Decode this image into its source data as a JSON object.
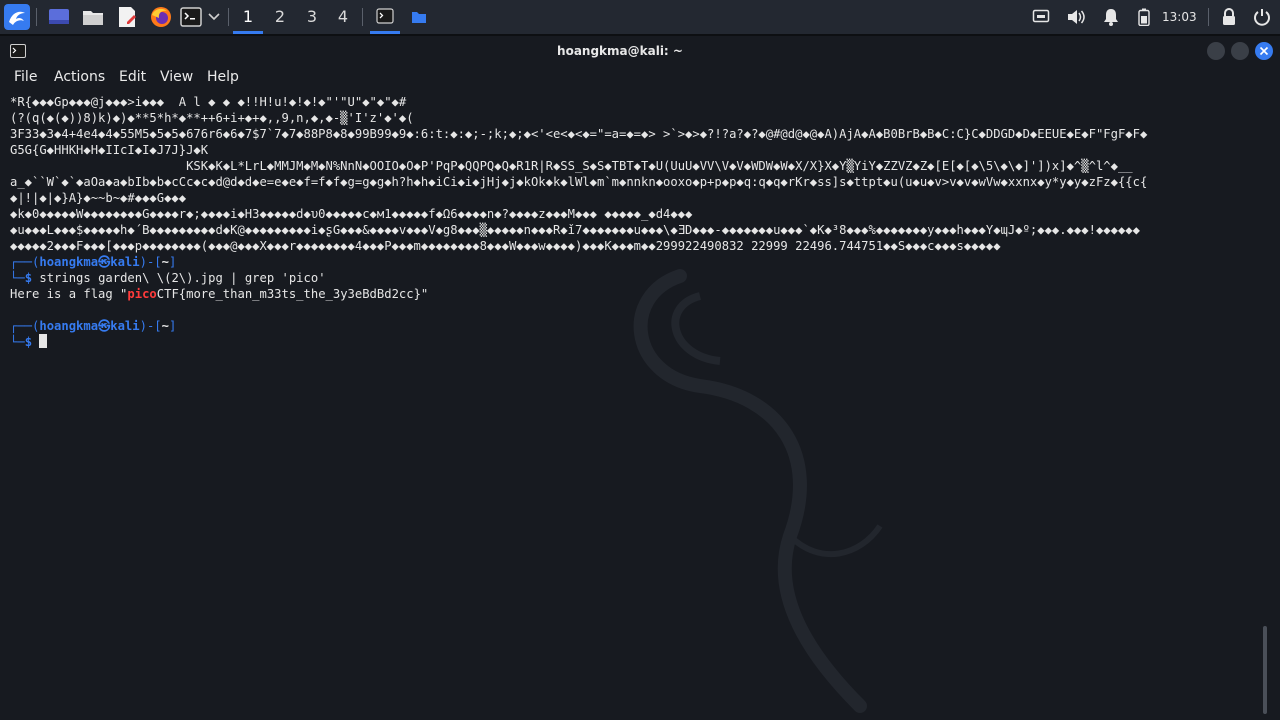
{
  "taskbar": {
    "workspaces": [
      "1",
      "2",
      "3",
      "4"
    ],
    "active_workspace": "1",
    "clock": "13:03",
    "accent_color": "#367bf0"
  },
  "window": {
    "title": "hoangkma@kali: ~",
    "menu": [
      "File",
      "Actions",
      "Edit",
      "View",
      "Help"
    ]
  },
  "terminal": {
    "binary_output": [
      "*R{◆◆◆Gp◆◆◆@j◆◆◆>i◆◆◆  A l ◆ ◆ ◆!!H!u!◆!◆!◆\"'\"U\"◆\"◆\"◆#",
      "(?(q(◆(◆))8)k)◆)◆**5*h*◆**++6+i+◆+◆,,9,n,◆,◆-▒'I'z'◆'◆(",
      "3F33◆3◆4+4e4◆4◆55M5◆5◆5◆676r6◆6◆7$7`7◆7◆88P8◆8◆99B99◆9◆:6:t:◆:◆;-;k;◆;◆<'<e<◆<◆=\"=a=◆=◆> >`>◆>◆?!?a?◆?◆@#@d@◆@◆A)AjA◆A◆B0BrB◆B◆C:C}C◆DDGD◆D◆EEUE◆E◆F\"FgF◆F◆",
      "G5G{G◆HHKH◆H◆IIcI◆I◆J7J}J◆K",
      "                        KSK◆K◆L*LrL◆MMJM◆M◆N%NnN◆OOIO◆O◆P'PqP◆QQPQ◆Q◆R1R|R◆SS_S◆S◆TBT◆T◆U(UuU◆VV\\V◆V◆WDW◆W◆X/X}X◆Y▒YiY◆ZZVZ◆Z◆[E[◆[◆\\5\\◆\\◆]'])x]◆^▒^l^◆__",
      "a_◆``W`◆`◆aOa◆a◆bIb◆b◆cCc◆c◆d@d◆d◆e=e◆e◆f=f◆f◆g=g◆g◆h?h◆h◆iCi◆i◆jHj◆j◆kOk◆k◆lWl◆m`m◆nnkn◆ooxo◆p+p◆p◆q:q◆q◆rKr◆ss]s◆ttpt◆u(u◆u◆v>v◆v◆wVw◆xxnx◆y*y◆y◆zFz◆{{c{",
      "◆|!|◆|◆}A}◆~~b~◆#◆◆◆G◆◆◆",
      "◆k◆0◆◆◆◆◆W◆◆◆◆◆◆◆◆G◆◆◆◆r◆;◆◆◆◆i◆H3◆◆◆◆◆d◆υ0◆◆◆◆◆c◆м1◆◆◆◆◆f◆Ω6◆◆◆◆n◆?◆◆◆◆z◆◆◆M◆◆◆ ◆◆◆◆◆_◆d4◆◆◆",
      "◆u◆◆◆L◆◆◆$◆◆◆◆◆h◆´B◆◆◆◆◆◆◆◆◆d◆K@◆◆◆◆◆◆◆◆◆i◆ʂG◆◆◆&◆◆◆◆v◆◆◆V◆g8◆◆◆▒◆◆◆◆◆n◆◆◆R◆ǐ7◆◆◆◆◆◆◆u◆◆◆\\◆ƎD◆◆◆-◆◆◆◆◆◆◆u◆◆◆`◆K◆³8◆◆◆%◆◆◆◆◆◆◆y◆◆◆h◆◆◆Y◆ɰJ◆º;◆◆◆.◆◆◆!◆◆◆◆◆◆",
      "◆◆◆◆◆2◆◆◆F◆◆◆[◆◆◆p◆◆◆◆◆◆◆◆(◆◆◆@◆◆◆X◆◆◆r◆◆◆◆◆◆◆◆4◆◆◆P◆◆◆m◆◆◆◆◆◆◆◆8◆◆◆W◆◆◆w◆◆◆◆)◆◆◆K◆◆◆m◆◆299922490832 22999 22496.744751◆◆S◆◆◆c◆◆◆s◆◆◆◆◆"
    ],
    "prompt": {
      "top_left": "┌──(",
      "user": "hoangkma",
      "at": "㉿",
      "host": "kali",
      "mid": ")-[",
      "dir": "~",
      "end": "]",
      "bottom_left": "└─",
      "symbol": "$"
    },
    "command": "strings garden\\ \\(2\\).jpg | grep 'pico'",
    "result": {
      "prefix": "Here is a flag \"",
      "match": "pico",
      "suffix": "CTF{more_than_m33ts_the_3y3eBdBd2cc}\""
    }
  }
}
